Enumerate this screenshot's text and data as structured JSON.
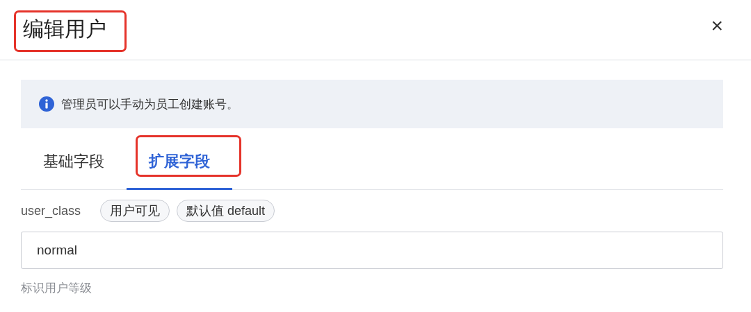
{
  "dialog": {
    "title": "编辑用户",
    "title_highlighted": true,
    "close": "×"
  },
  "notice": {
    "text": "管理员可以手动为员工创建账号。"
  },
  "tabs": [
    {
      "label": "基础字段",
      "selected": false,
      "highlighted": false
    },
    {
      "label": "扩展字段",
      "selected": true,
      "highlighted": true
    }
  ],
  "field": {
    "label": "user_class",
    "tags": [
      "用户可见",
      "默认值 default"
    ],
    "value": "normal",
    "help": "标识用户等级"
  }
}
